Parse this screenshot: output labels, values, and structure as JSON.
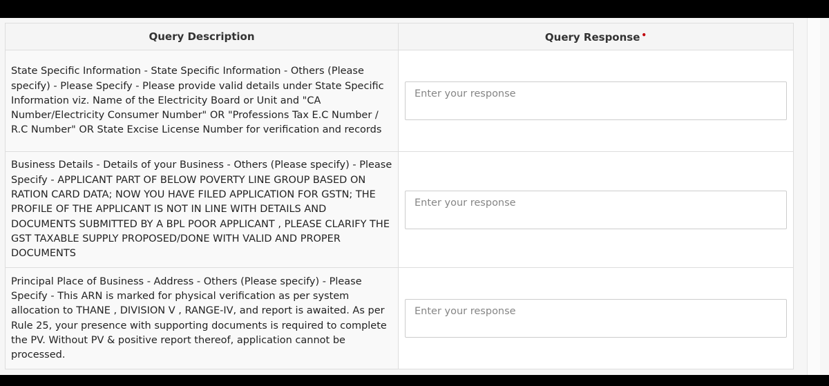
{
  "table": {
    "headers": {
      "description": "Query Description",
      "response": "Query Response",
      "required_mark": "•"
    },
    "rows": [
      {
        "description": "State Specific Information - State Specific Information - Others (Please specify) - Please Specify - Please provide valid details under State Specific Information viz. Name of the Electricity Board or Unit and \"CA Number/Electricity Consumer Number\" OR \"Professions Tax E.C Number / R.C Number\" OR State Excise License Number for verification and records",
        "response_placeholder": "Enter your response"
      },
      {
        "description": "Business Details - Details of your Business - Others (Please specify) - Please Specify - APPLICANT PART OF BELOW POVERTY LINE GROUP BASED ON RATION CARD DATA; NOW YOU HAVE FILED APPLICATION FOR GSTN; THE PROFILE OF THE APPLICANT IS NOT IN LINE WITH DETAILS AND DOCUMENTS SUBMITTED BY A BPL POOR APPLICANT , PLEASE CLARIFY THE GST TAXABLE SUPPLY PROPOSED/DONE WITH VALID AND PROPER DOCUMENTS",
        "response_placeholder": "Enter your response"
      },
      {
        "description": "Principal Place of Business - Address - Others (Please specify) - Please Specify - This ARN is marked for physical verification as per system allocation to THANE , DIVISION V , RANGE-IV, and report is awaited. As per Rule 25, your presence with supporting documents is required to complete the PV. Without PV & positive report thereof, application cannot be processed.",
        "response_placeholder": "Enter your response"
      }
    ]
  },
  "colors": {
    "required_mark": "#c0000b",
    "header_background": "#f5f5f5",
    "border": "#dddddd"
  }
}
